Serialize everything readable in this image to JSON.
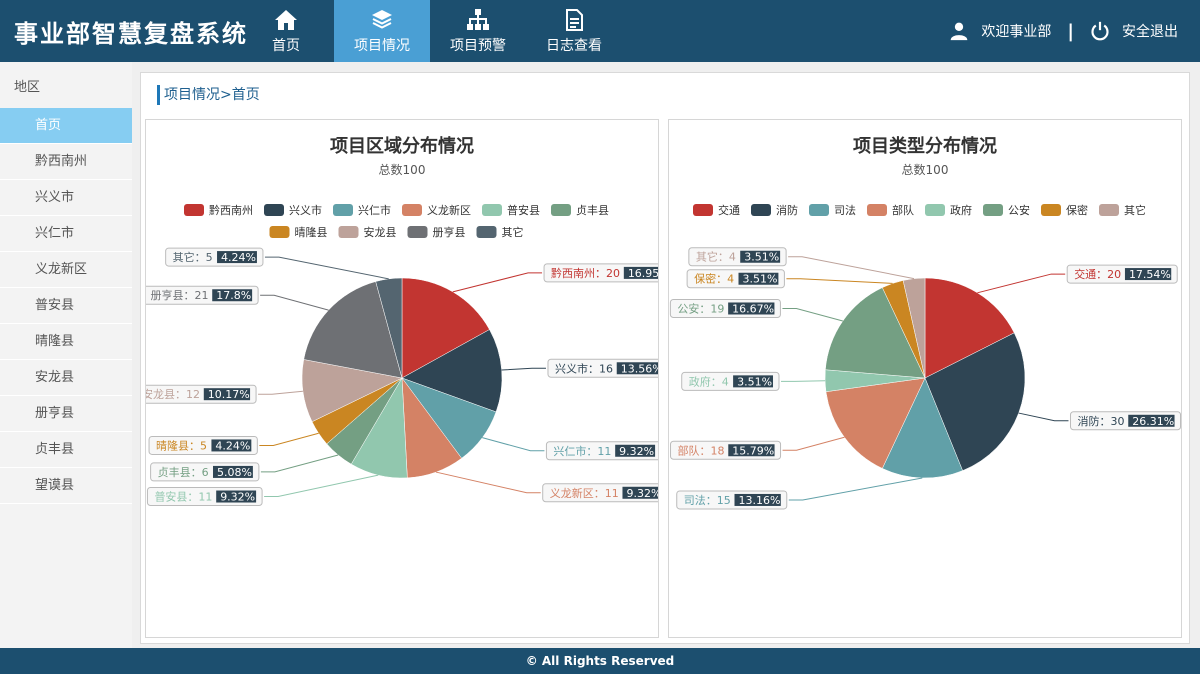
{
  "app": {
    "brand": "事业部智慧复盘系统"
  },
  "nav": [
    {
      "label": "首页",
      "icon": "home-icon",
      "active": false
    },
    {
      "label": "项目情况",
      "icon": "layers-icon",
      "active": true
    },
    {
      "label": "项目预警",
      "icon": "org-chart-icon",
      "active": false
    },
    {
      "label": "日志查看",
      "icon": "document-icon",
      "active": false
    }
  ],
  "user": {
    "welcome": "欢迎事业部",
    "separator": "|",
    "logout": "安全退出"
  },
  "sidebar": {
    "title": "地区",
    "items": [
      {
        "label": "首页",
        "active": true
      },
      {
        "label": "黔西南州"
      },
      {
        "label": "兴义市"
      },
      {
        "label": "兴仁市"
      },
      {
        "label": "义龙新区"
      },
      {
        "label": "普安县"
      },
      {
        "label": "晴隆县"
      },
      {
        "label": "安龙县"
      },
      {
        "label": "册亨县"
      },
      {
        "label": "贞丰县"
      },
      {
        "label": "望谟县"
      }
    ]
  },
  "breadcrumb": "项目情况>首页",
  "footer": "© All Rights Reserved",
  "chart_data": [
    {
      "type": "pie",
      "title": "项目区域分布情况",
      "subtitle": "总数100",
      "legend_position": "top",
      "categories": [
        "黔西南州",
        "兴义市",
        "兴仁市",
        "义龙新区",
        "普安县",
        "贞丰县",
        "晴隆县",
        "安龙县",
        "册亨县",
        "其它"
      ],
      "values": [
        20,
        16,
        11,
        11,
        11,
        6,
        5,
        12,
        21,
        5
      ],
      "percents": [
        "16.95%",
        "13.56%",
        "9.32%",
        "9.32%",
        "9.32%",
        "5.08%",
        "4.24%",
        "10.17%",
        "17.8%",
        "4.24%"
      ],
      "colors": [
        "#c23531",
        "#2f4554",
        "#61a0a8",
        "#d48265",
        "#91c7ae",
        "#749f83",
        "#ca8622",
        "#bda29a",
        "#6e7074",
        "#546570"
      ],
      "legend": [
        {
          "name": "黔西南州",
          "color": "#c23531"
        },
        {
          "name": "兴义市",
          "color": "#2f4554"
        },
        {
          "name": "兴仁市",
          "color": "#61a0a8"
        },
        {
          "name": "义龙新区",
          "color": "#d48265"
        },
        {
          "name": "普安县",
          "color": "#91c7ae"
        },
        {
          "name": "贞丰县",
          "color": "#749f83"
        },
        {
          "name": "晴隆县",
          "color": "#ca8622"
        },
        {
          "name": "安龙县",
          "color": "#bda29a"
        },
        {
          "name": "册亨县",
          "color": "#6e7074"
        },
        {
          "name": "其它",
          "color": "#546570"
        }
      ]
    },
    {
      "type": "pie",
      "title": "项目类型分布情况",
      "subtitle": "总数100",
      "legend_position": "top",
      "categories": [
        "交通",
        "消防",
        "司法",
        "部队",
        "政府",
        "公安",
        "保密",
        "其它"
      ],
      "values": [
        20,
        30,
        15,
        18,
        4,
        19,
        4,
        4
      ],
      "percents": [
        "17.54%",
        "26.31%",
        "13.16%",
        "15.79%",
        "3.51%",
        "16.67%",
        "3.51%",
        "3.51%"
      ],
      "colors": [
        "#c23531",
        "#2f4554",
        "#61a0a8",
        "#d48265",
        "#91c7ae",
        "#749f83",
        "#ca8622",
        "#bda29a"
      ],
      "legend": [
        {
          "name": "交通",
          "color": "#c23531"
        },
        {
          "name": "消防",
          "color": "#2f4554"
        },
        {
          "name": "司法",
          "color": "#61a0a8"
        },
        {
          "name": "部队",
          "color": "#d48265"
        },
        {
          "name": "政府",
          "color": "#91c7ae"
        },
        {
          "name": "公安",
          "color": "#749f83"
        },
        {
          "name": "保密",
          "color": "#ca8622"
        },
        {
          "name": "其它",
          "color": "#bda29a"
        }
      ]
    }
  ]
}
